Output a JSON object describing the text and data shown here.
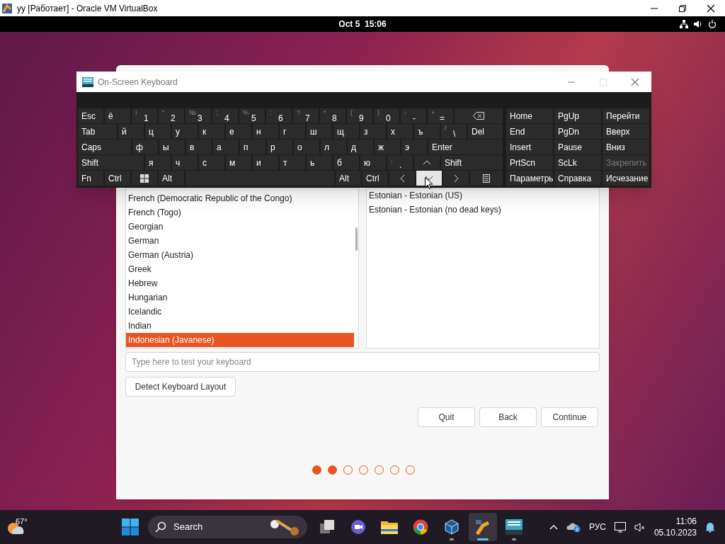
{
  "host_window": {
    "title": "уу [Работает] - Oracle VM VirtualBox"
  },
  "guest_topbar": {
    "clock": "Oct 5  15:06"
  },
  "installer": {
    "layouts": [
      {
        "label": "French (Democratic Republic of the Congo)",
        "selected": false
      },
      {
        "label": "French (Togo)",
        "selected": false
      },
      {
        "label": "Georgian",
        "selected": false
      },
      {
        "label": "German",
        "selected": false
      },
      {
        "label": "German (Austria)",
        "selected": false
      },
      {
        "label": "Greek",
        "selected": false
      },
      {
        "label": "Hebrew",
        "selected": false
      },
      {
        "label": "Hungarian",
        "selected": false
      },
      {
        "label": "Icelandic",
        "selected": false
      },
      {
        "label": "Indian",
        "selected": false
      },
      {
        "label": "Indonesian (Javanese)",
        "selected": true
      }
    ],
    "variants": [
      {
        "label": "Estonian - Estonian (US)",
        "selected": false
      },
      {
        "label": "Estonian - Estonian (no dead keys)",
        "selected": false
      }
    ],
    "test_field": {
      "placeholder": "Type here to test your keyboard"
    },
    "detect_button": "Detect Keyboard Layout",
    "buttons": [
      "Quit",
      "Back",
      "Continue"
    ],
    "steps": [
      {
        "done": true
      },
      {
        "done": true
      },
      {
        "done": false
      },
      {
        "done": false
      },
      {
        "done": false
      },
      {
        "done": false
      },
      {
        "done": false
      }
    ]
  },
  "osk": {
    "title": "On-Screen Keyboard",
    "rows": [
      {
        "keys": [
          {
            "kind": "text",
            "label": "Esc"
          },
          {
            "kind": "text",
            "label": "ё"
          },
          {
            "kind": "text",
            "label": "1",
            "secondary": "!"
          },
          {
            "kind": "text",
            "label": "2",
            "secondary": "\""
          },
          {
            "kind": "text",
            "label": "3",
            "secondary": "№"
          },
          {
            "kind": "text",
            "label": "4",
            "secondary": ";"
          },
          {
            "kind": "text",
            "label": "5",
            "secondary": "%"
          },
          {
            "kind": "text",
            "label": "6",
            "secondary": ":"
          },
          {
            "kind": "text",
            "label": "7",
            "secondary": "?"
          },
          {
            "kind": "text",
            "label": "8",
            "secondary": "*"
          },
          {
            "kind": "text",
            "label": "9",
            "secondary": "("
          },
          {
            "kind": "text",
            "label": "0",
            "secondary": ")"
          },
          {
            "kind": "text",
            "label": "-",
            "secondary": "-"
          },
          {
            "kind": "text",
            "label": "=",
            "secondary": "+"
          },
          {
            "kind": "backspace"
          }
        ]
      },
      {
        "keys": [
          {
            "kind": "text",
            "label": "Tab"
          },
          {
            "kind": "text",
            "label": "й"
          },
          {
            "kind": "text",
            "label": "ц"
          },
          {
            "kind": "text",
            "label": "у"
          },
          {
            "kind": "text",
            "label": "к"
          },
          {
            "kind": "text",
            "label": "е"
          },
          {
            "kind": "text",
            "label": "н"
          },
          {
            "kind": "text",
            "label": "г"
          },
          {
            "kind": "text",
            "label": "ш"
          },
          {
            "kind": "text",
            "label": "щ"
          },
          {
            "kind": "text",
            "label": "з"
          },
          {
            "kind": "text",
            "label": "х"
          },
          {
            "kind": "text",
            "label": "ъ"
          },
          {
            "kind": "text",
            "label": "\\",
            "secondary": "/"
          },
          {
            "kind": "text",
            "label": "Del"
          }
        ]
      },
      {
        "keys": [
          {
            "kind": "text",
            "label": "Caps"
          },
          {
            "kind": "text",
            "label": "ф"
          },
          {
            "kind": "text",
            "label": "ы"
          },
          {
            "kind": "text",
            "label": "в"
          },
          {
            "kind": "text",
            "label": "а"
          },
          {
            "kind": "text",
            "label": "п"
          },
          {
            "kind": "text",
            "label": "р"
          },
          {
            "kind": "text",
            "label": "о"
          },
          {
            "kind": "text",
            "label": "л"
          },
          {
            "kind": "text",
            "label": "д"
          },
          {
            "kind": "text",
            "label": "ж"
          },
          {
            "kind": "text",
            "label": "э"
          },
          {
            "kind": "text",
            "label": "Enter"
          }
        ]
      },
      {
        "keys": [
          {
            "kind": "text",
            "label": "Shift"
          },
          {
            "kind": "text",
            "label": "я"
          },
          {
            "kind": "text",
            "label": "ч"
          },
          {
            "kind": "text",
            "label": "с"
          },
          {
            "kind": "text",
            "label": "м"
          },
          {
            "kind": "text",
            "label": "и"
          },
          {
            "kind": "text",
            "label": "т"
          },
          {
            "kind": "text",
            "label": "ь"
          },
          {
            "kind": "text",
            "label": "б"
          },
          {
            "kind": "text",
            "label": "ю"
          },
          {
            "kind": "text",
            "label": ".",
            "secondary": ","
          },
          {
            "kind": "up"
          },
          {
            "kind": "text",
            "label": "Shift"
          }
        ]
      },
      {
        "keys": [
          {
            "kind": "text",
            "label": "Fn",
            "pressed": false
          },
          {
            "kind": "text",
            "label": "Ctrl",
            "pressed": false
          },
          {
            "kind": "windows",
            "pressed": false
          },
          {
            "kind": "text",
            "label": "Alt",
            "pressed": false
          },
          {
            "kind": "space",
            "pressed": false
          },
          {
            "kind": "text",
            "label": "Alt",
            "pressed": false
          },
          {
            "kind": "text",
            "label": "Ctrl",
            "pressed": false
          },
          {
            "kind": "left",
            "pressed": false
          },
          {
            "kind": "down",
            "pressed": true
          },
          {
            "kind": "right",
            "pressed": false
          },
          {
            "kind": "menu",
            "pressed": false
          }
        ]
      }
    ],
    "nav": [
      [
        {
          "label": "Home",
          "disabled": false
        },
        {
          "label": "PgUp",
          "disabled": false
        },
        {
          "label": "Перейти",
          "disabled": false
        }
      ],
      [
        {
          "label": "End",
          "disabled": false
        },
        {
          "label": "PgDn",
          "disabled": false
        },
        {
          "label": "Вверх",
          "disabled": false
        }
      ],
      [
        {
          "label": "Insert",
          "disabled": false
        },
        {
          "label": "Pause",
          "disabled": false
        },
        {
          "label": "Вниз",
          "disabled": false
        }
      ],
      [
        {
          "label": "PrtScn",
          "disabled": false
        },
        {
          "label": "ScLk",
          "disabled": false
        },
        {
          "label": "Закрепить",
          "disabled": true
        }
      ],
      [
        {
          "label": "Параметрь",
          "disabled": false
        },
        {
          "label": "Справка",
          "disabled": false
        },
        {
          "label": "Исчезание",
          "disabled": false
        }
      ]
    ]
  },
  "taskbar": {
    "weather": {
      "temperature": "67°"
    },
    "search": {
      "label": "Search"
    },
    "apps": [
      {
        "kind": "task-view",
        "running": false,
        "active": false
      },
      {
        "kind": "chat",
        "running": false,
        "active": false
      },
      {
        "kind": "folder",
        "running": false,
        "active": false
      },
      {
        "kind": "browser",
        "running": false,
        "active": false
      },
      {
        "kind": "cube",
        "running": true,
        "active": false
      },
      {
        "kind": "vm-app",
        "running": true,
        "active": true
      },
      {
        "kind": "keyboard",
        "running": true,
        "active": false
      }
    ],
    "language": "РУС",
    "time": "11:06",
    "date": "05.10.2023"
  }
}
